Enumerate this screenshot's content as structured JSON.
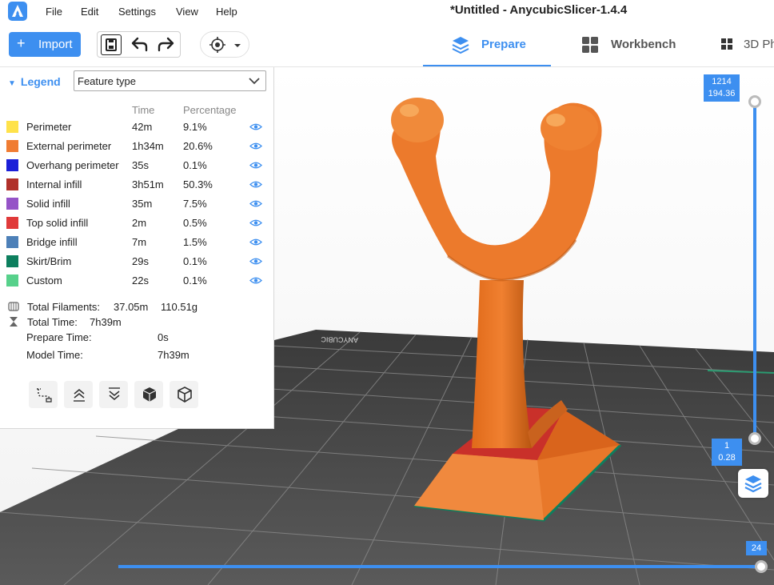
{
  "window": {
    "title": "*Untitled - AnycubicSlicer-1.4.4",
    "menu": [
      "File",
      "Edit",
      "Settings",
      "View",
      "Help"
    ]
  },
  "toolbar": {
    "import_label": "Import",
    "tabs": [
      "Prepare",
      "Workbench",
      "3D Ph"
    ],
    "active_tab": "Prepare",
    "accent": "#3d8ff0"
  },
  "legend": {
    "title": "Legend",
    "view_mode": "Feature type",
    "col_time": "Time",
    "col_percentage": "Percentage",
    "rows": [
      {
        "name": "Perimeter",
        "time": "42m",
        "pct": "9.1%",
        "color": "#ffe24a"
      },
      {
        "name": "External perimeter",
        "time": "1h34m",
        "pct": "20.6%",
        "color": "#f07c32"
      },
      {
        "name": "Overhang perimeter",
        "time": "35s",
        "pct": "0.1%",
        "color": "#1b1fd8"
      },
      {
        "name": "Internal infill",
        "time": "3h51m",
        "pct": "50.3%",
        "color": "#b0302a"
      },
      {
        "name": "Solid infill",
        "time": "35m",
        "pct": "7.5%",
        "color": "#9553c7"
      },
      {
        "name": "Top solid infill",
        "time": "2m",
        "pct": "0.5%",
        "color": "#e03a3a"
      },
      {
        "name": "Bridge infill",
        "time": "7m",
        "pct": "1.5%",
        "color": "#4d80b8"
      },
      {
        "name": "Skirt/Brim",
        "time": "29s",
        "pct": "0.1%",
        "color": "#0d7f5e"
      },
      {
        "name": "Custom",
        "time": "22s",
        "pct": "0.1%",
        "color": "#57d18b"
      }
    ],
    "total_filaments_label": "Total Filaments:",
    "total_filaments_len": "37.05m",
    "total_filaments_weight": "110.51g",
    "total_time_label": "Total Time:",
    "total_time": "7h39m",
    "prepare_time_label": "Prepare Time:",
    "prepare_time": "0s",
    "model_time_label": "Model Time:",
    "model_time": "7h39m"
  },
  "slider": {
    "top_layer": "1214",
    "top_height": "194.36",
    "bottom_layer": "1",
    "bottom_height": "0.28",
    "horizontal_value": "24"
  },
  "bed": {
    "brand_text": "ANYCUBIC"
  }
}
